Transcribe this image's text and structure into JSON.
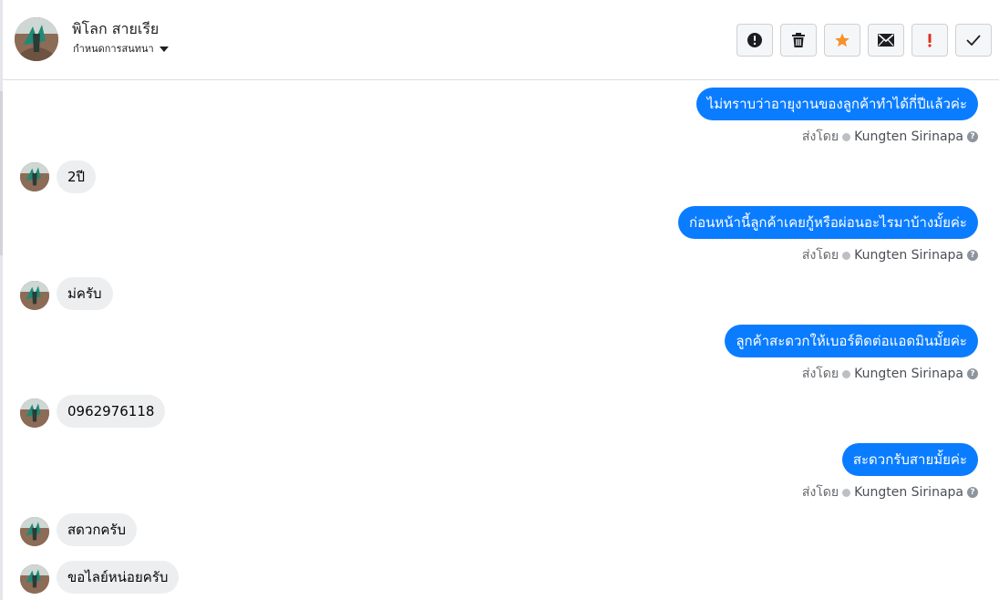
{
  "contact": {
    "name": "พิโลก สายเรีย",
    "setting_label": "กำหนดการสนทนา"
  },
  "toolbar": {
    "buttons": [
      {
        "name": "alert-circle-icon",
        "title": "report"
      },
      {
        "name": "trash-icon",
        "title": "delete"
      },
      {
        "name": "star-icon",
        "title": "star"
      },
      {
        "name": "envelope-icon",
        "title": "mark unread"
      },
      {
        "name": "exclamation-icon",
        "title": "important"
      },
      {
        "name": "check-icon",
        "title": "done"
      }
    ],
    "colors": {
      "star": "#f5922b",
      "exclamation": "#e0301e",
      "icon": "#1c1e21"
    }
  },
  "meta": {
    "sent_by_label": "ส่งโดย",
    "agent_name": "Kungten Sirinapa",
    "help_glyph": "?"
  },
  "messages": [
    {
      "dir": "out",
      "text": "ไม่ทราบว่าอายุงานของลูกค้าทำได้กี่ปีแล้วค่ะ"
    },
    {
      "dir": "in",
      "text": "2ปี"
    },
    {
      "dir": "out",
      "text": "ก่อนหน้านี้ลูกค้าเคยกู้หรือผ่อนอะไรมาบ้างมั้ยค่ะ"
    },
    {
      "dir": "in",
      "text": "ม่ครับ"
    },
    {
      "dir": "out",
      "text": "ลูกค้าสะดวกให้เบอร์ติดต่อแอดมินมั้ยค่ะ"
    },
    {
      "dir": "in",
      "text": "0962976118"
    },
    {
      "dir": "out",
      "text": "สะดวกรับสายมั้ยค่ะ"
    },
    {
      "dir": "in",
      "text": "สดวกครับ"
    },
    {
      "dir": "in",
      "text": "ขอไลย์หน่อยครับ"
    }
  ],
  "theme": {
    "outgoing": "#0a7cff",
    "incoming": "#eceef0"
  }
}
